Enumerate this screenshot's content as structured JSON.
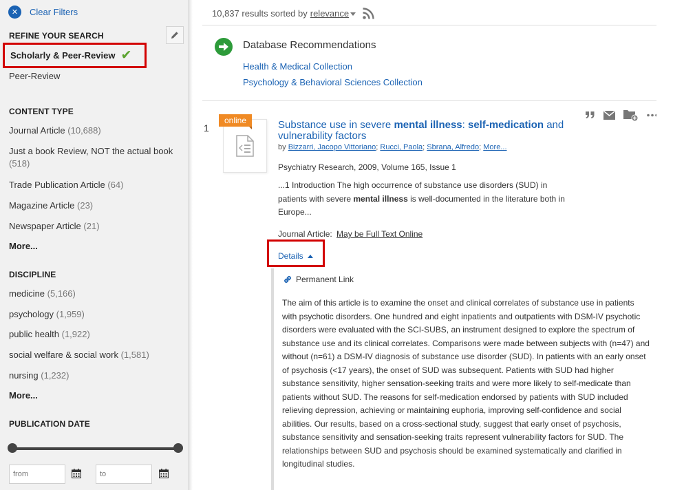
{
  "sidebar": {
    "clear_filters": "Clear Filters",
    "refine_heading": "REFINE YOUR SEARCH",
    "scholarly": "Scholarly & Peer-Review",
    "peer_review": "Peer-Review",
    "content_type": {
      "heading": "CONTENT TYPE",
      "items": [
        {
          "label": "Journal Article",
          "count": "(10,688)"
        },
        {
          "label": "Just a book Review, NOT the actual book",
          "count": "(518)"
        },
        {
          "label": "Trade Publication Article",
          "count": "(64)"
        },
        {
          "label": "Magazine Article",
          "count": "(23)"
        },
        {
          "label": "Newspaper Article",
          "count": "(21)"
        }
      ],
      "more": "More..."
    },
    "discipline": {
      "heading": "DISCIPLINE",
      "items": [
        {
          "label": "medicine",
          "count": "(5,166)"
        },
        {
          "label": "psychology",
          "count": "(1,959)"
        },
        {
          "label": "public health",
          "count": "(1,922)"
        },
        {
          "label": "social welfare & social work",
          "count": "(1,581)"
        },
        {
          "label": "nursing",
          "count": "(1,232)"
        }
      ],
      "more": "More..."
    },
    "publication_date": {
      "heading": "PUBLICATION DATE",
      "from_placeholder": "from",
      "to_placeholder": "to"
    }
  },
  "main": {
    "results_count": "10,837 results sorted by",
    "sort_by": "relevance",
    "db_recommendations": {
      "title": "Database Recommendations",
      "links": [
        "Health & Medical Collection",
        "Psychology & Behavioral Sciences Collection"
      ]
    },
    "result": {
      "number": "1",
      "badge": "online",
      "title_parts": {
        "p1": "Substance use in severe ",
        "b1": "mental illness",
        "p2": ": ",
        "b2": "self-medication",
        "p3": " and vulnerability factors"
      },
      "authors_prefix": "by",
      "authors": [
        "Bizzarri, Jacopo Vittoriano",
        "Rucci, Paola",
        "Sbrana, Alfredo"
      ],
      "authors_more": "More...",
      "pubinfo": "Psychiatry Research, 2009, Volume 165, Issue 1",
      "snippet_parts": {
        "p1": "...1 Introduction The high occurrence of substance use disorders (SUD) in patients with severe ",
        "b1": "mental illness",
        "p2": " is well-documented in the literature both in Europe..."
      },
      "type_label": "Journal Article:",
      "fulltext": "May be Full Text Online",
      "details": "Details",
      "permalink": "Permanent Link",
      "abstract": "The aim of this article is to examine the onset and clinical correlates of substance use in patients with psychotic disorders. One hundred and eight inpatients and outpatients with DSM-IV psychotic disorders were evaluated with the SCI-SUBS, an instrument designed to explore the spectrum of substance use and its clinical correlates. Comparisons were made between subjects with (n=47) and without (n=61) a DSM-IV diagnosis of substance use disorder (SUD). In patients with an early onset of psychosis (<17 years), the onset of SUD was subsequent. Patients with SUD had higher substance sensitivity, higher sensation-seeking traits and were more likely to self-medicate than patients without SUD. The reasons for self-medication endorsed by patients with SUD included relieving depression, achieving or maintaining euphoria, improving self-confidence and social abilities. Our results, based on a cross-sectional study, suggest that early onset of psychosis, substance sensitivity and sensation-seeking traits represent vulnerability factors for SUD. The relationships between SUD and psychosis should be examined systematically and clarified in longitudinal studies."
    },
    "actions": [
      "cite-icon",
      "email-icon",
      "folder-add-icon",
      "more-icon"
    ]
  },
  "colors": {
    "link": "#1a62b3",
    "highlight_border": "#d20000",
    "badge": "#f08a24",
    "check": "#5ba32f",
    "db_icon": "#2d9b3a"
  }
}
